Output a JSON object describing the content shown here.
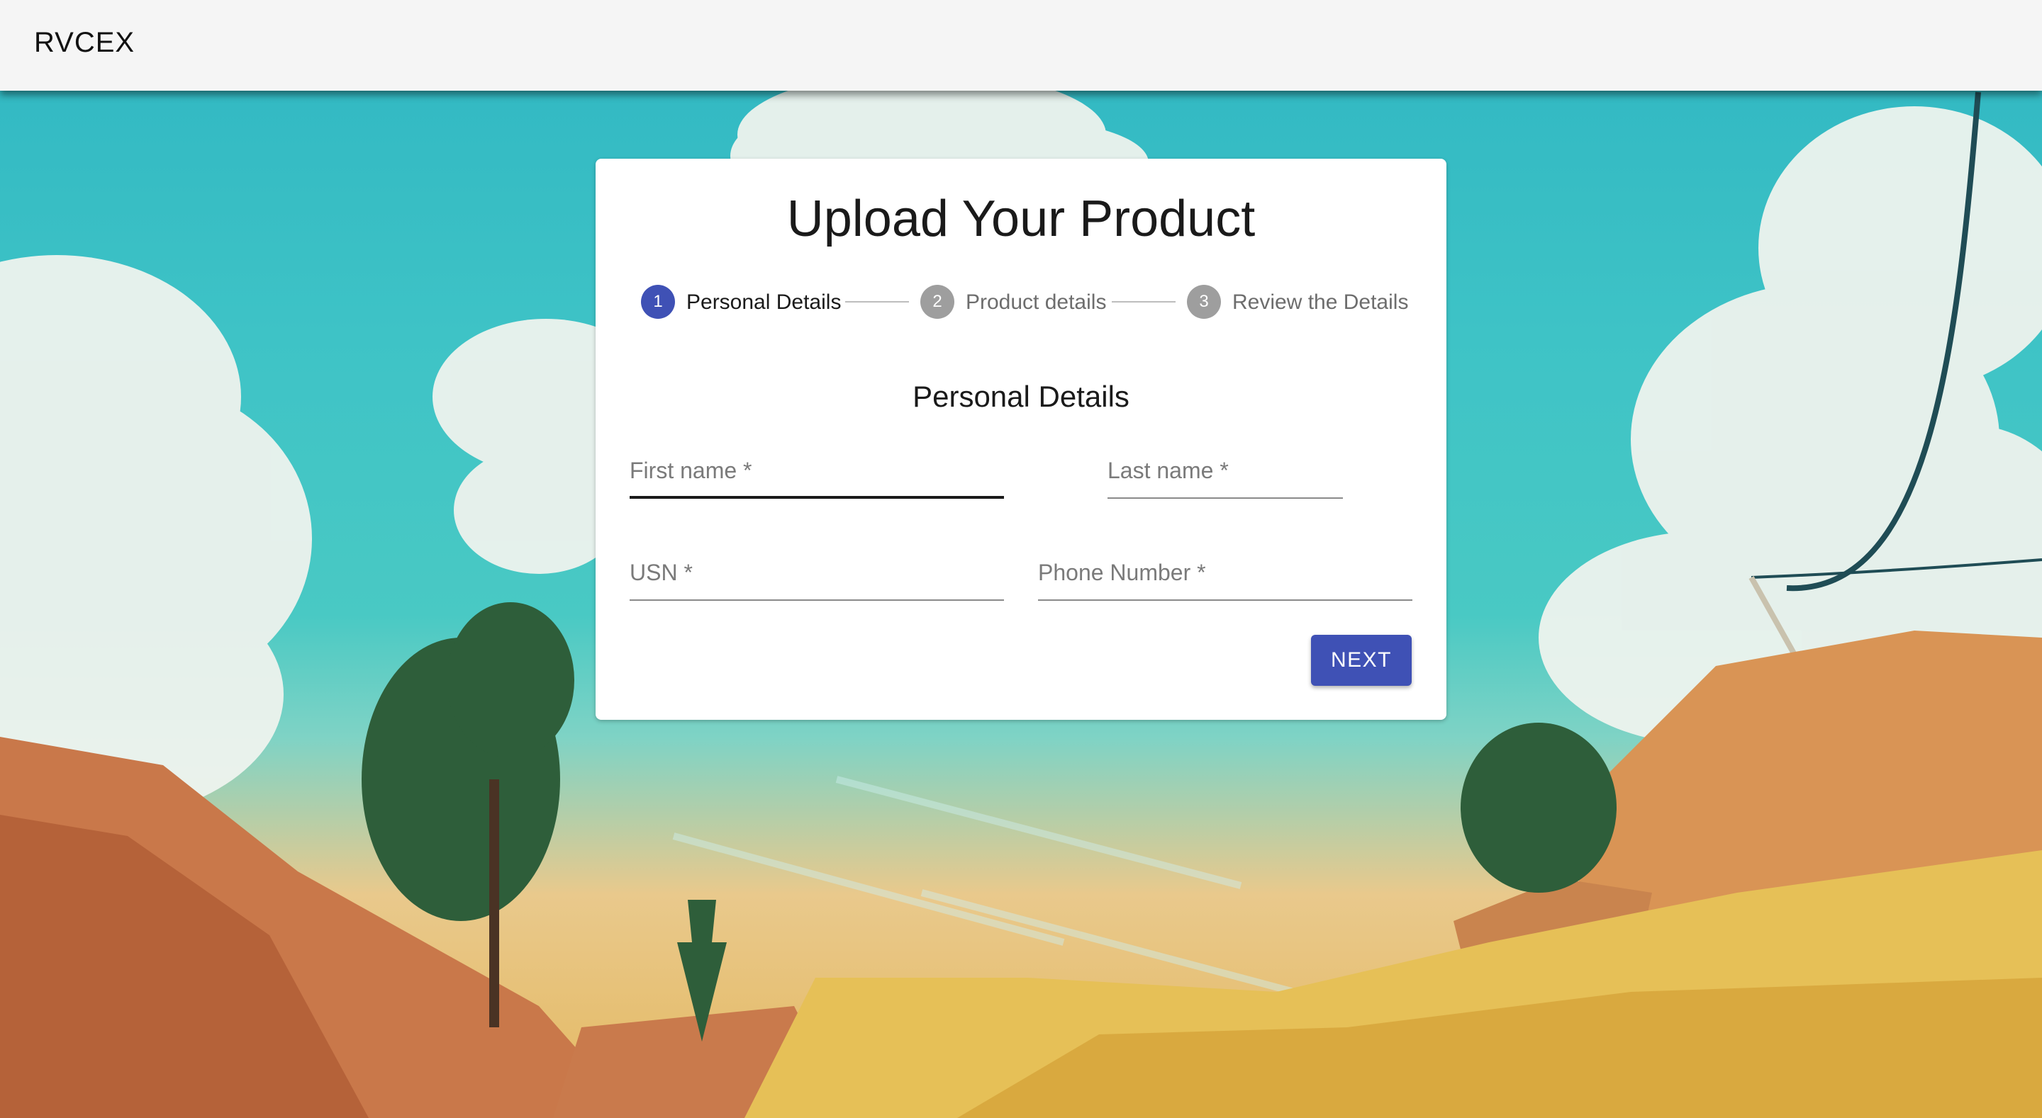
{
  "appbar": {
    "brand": "RVCEX"
  },
  "card": {
    "title": "Upload Your Product",
    "section_title": "Personal Details"
  },
  "stepper": {
    "steps": [
      {
        "number": "1",
        "label": "Personal Details",
        "state": "active"
      },
      {
        "number": "2",
        "label": "Product details",
        "state": "inactive"
      },
      {
        "number": "3",
        "label": "Review the Details",
        "state": "inactive"
      }
    ]
  },
  "form": {
    "first_name": {
      "label": "First name",
      "required": "*",
      "value": ""
    },
    "last_name": {
      "label": "Last name",
      "required": "*",
      "value": ""
    },
    "usn": {
      "label": "USN",
      "required": "*",
      "value": ""
    },
    "phone": {
      "label": "Phone Number",
      "required": "*",
      "value": ""
    }
  },
  "actions": {
    "next_label": "NEXT"
  },
  "colors": {
    "primary": "#3f51b5",
    "step_inactive": "#9e9e9e",
    "appbar": "#f5f5f5"
  }
}
